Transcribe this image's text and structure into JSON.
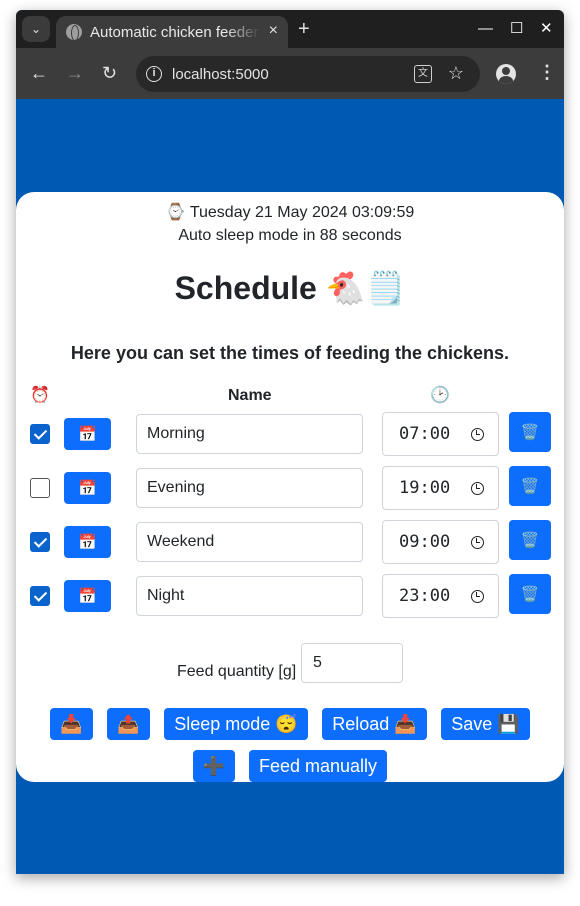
{
  "browser": {
    "tab_title": "Automatic chicken feeder",
    "tab_close": "×",
    "new_tab": "+",
    "menu_caret": "⌄",
    "url": "localhost:5000",
    "info": "i",
    "translate": "文",
    "star": "☆",
    "kebab": "⋮",
    "back": "←",
    "forward": "→",
    "reload": "↻",
    "minimize": "—",
    "maximize": "☐",
    "close": "✕"
  },
  "page": {
    "datetime": "⌚ Tuesday 21 May 2024 03:09:59",
    "sleep_note": "Auto sleep mode in 88 seconds",
    "heading": "Schedule 🐔🗒️",
    "intro": "Here you can set the times of feeding the chickens.",
    "headers": {
      "alarm_icon": "⏰",
      "name": "Name",
      "time_icon": "🕑"
    },
    "schedule": [
      {
        "enabled": true,
        "name": "Morning",
        "time": "07:00",
        "calendar_icon": "📅",
        "delete_icon": "🗑️"
      },
      {
        "enabled": false,
        "name": "Evening",
        "time": "19:00",
        "calendar_icon": "📅",
        "delete_icon": "🗑️"
      },
      {
        "enabled": true,
        "name": "Weekend",
        "time": "09:00",
        "calendar_icon": "📅",
        "delete_icon": "🗑️"
      },
      {
        "enabled": true,
        "name": "Night",
        "time": "23:00",
        "calendar_icon": "📅",
        "delete_icon": "🗑️"
      }
    ],
    "feed_quantity_label": "Feed quantity [g]",
    "feed_quantity_value": "5",
    "buttons": {
      "import_icon": "📥",
      "export_icon": "📤",
      "sleep_mode": "Sleep mode 😴",
      "reload": "Reload 📥",
      "save": "Save 💾",
      "add_icon": "➕",
      "feed_manually": "Feed manually"
    }
  },
  "colors": {
    "background": "#0059b3",
    "primary": "#0d6efd",
    "checkbox": "#0b63ce"
  }
}
